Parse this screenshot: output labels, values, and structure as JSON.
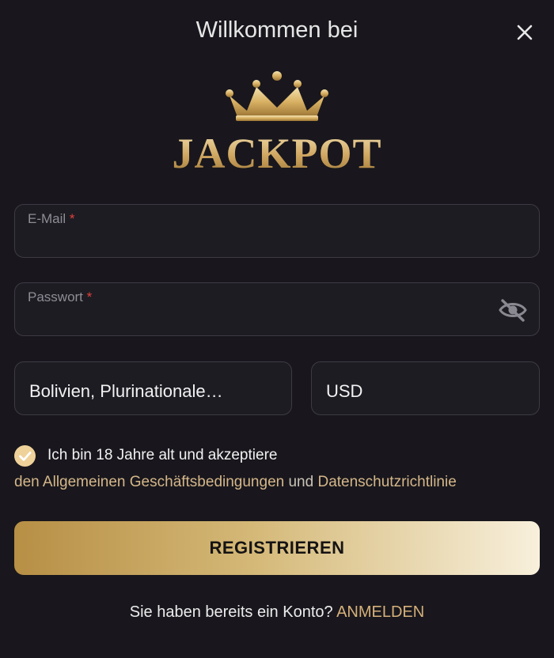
{
  "header": {
    "title": "Willkommen bei",
    "logo_text": "JACKPOT"
  },
  "form": {
    "email_label": "E-Mail",
    "password_label": "Passwort",
    "required_mark": "*",
    "country_value": "Bolivien, Plurinationale…",
    "currency_value": "USD"
  },
  "terms": {
    "line1": "Ich bin 18 Jahre alt und akzeptiere",
    "agb_link": "den Allgemeinen Geschäftsbedingungen",
    "and": "und",
    "privacy_link": "Datenschutzrichtlinie",
    "checked": true
  },
  "actions": {
    "register_label": "REGISTRIEREN",
    "login_prompt": "Sie haben bereits ein Konto?",
    "login_link": "ANMELDEN"
  },
  "colors": {
    "background": "#19171d",
    "gold": "#d5b07a",
    "required": "#e0413b"
  },
  "icons": [
    "close-icon",
    "crown-icon",
    "eye-off-icon",
    "checkmark-icon"
  ]
}
